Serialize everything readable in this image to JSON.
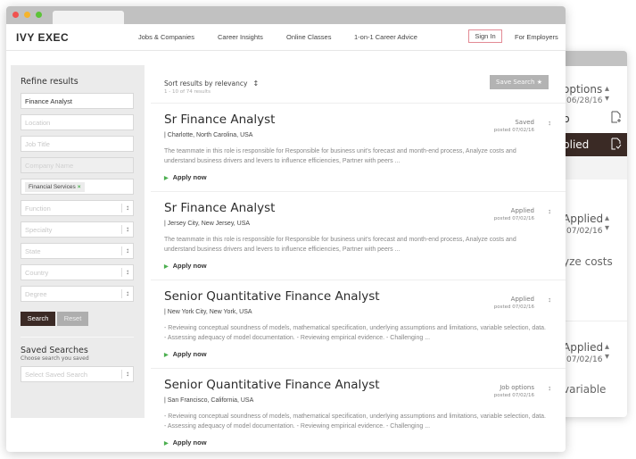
{
  "background_window": {
    "options_label": "options",
    "options_date": "06/28/16",
    "menu": [
      {
        "label": "b",
        "icon": "add-document-icon"
      },
      {
        "label": "plied",
        "icon": "checked-document-icon"
      }
    ],
    "cards": [
      {
        "status": "Applied",
        "date": "07/02/16",
        "text": "yze costs"
      },
      {
        "status": "Applied",
        "date": "07/02/16",
        "text": "variable"
      }
    ]
  },
  "browser": {
    "traffic_lights": [
      "close",
      "minimize",
      "maximize"
    ]
  },
  "navbar": {
    "logo": "IVY EXEC",
    "links": [
      "Jobs & Companies",
      "Career Insights",
      "Online Classes",
      "1-on-1 Career Advice"
    ],
    "sign_in": "Sign In",
    "for_employers": "For Employers"
  },
  "sidebar": {
    "title": "Refine results",
    "keyword_value": "Finance Analyst",
    "location_placeholder": "Location",
    "job_title_placeholder": "Job Title",
    "company_placeholder": "Company Name",
    "industry_chip": "Financial Services",
    "selects": [
      "Function",
      "Specialty",
      "State",
      "Country",
      "Degree"
    ],
    "search_button": "Search",
    "reset_button": "Reset",
    "saved_title": "Saved Searches",
    "saved_subtitle": "Choose search you saved",
    "saved_placeholder": "Select Saved Search"
  },
  "results": {
    "sort_label": "Sort results by relevancy",
    "count": "1 - 10 of 74 results",
    "save_search": "Save Search",
    "apply_label": "Apply now",
    "jobs": [
      {
        "title": "Sr Finance Analyst",
        "location": "| Charlotte, North Carolina, USA",
        "status": "Saved",
        "posted": "posted 07/02/16",
        "description": "The teammate in this role is responsible for Responsible for business unit's forecast and month-end process, Analyze costs and understand business drivers and levers to influence efficiencies,  Partner with peers ..."
      },
      {
        "title": "Sr Finance Analyst",
        "location": "| Jersey City, New Jersey, USA",
        "status": "Applied",
        "posted": "posted 07/02/16",
        "description": "The teammate in this role is responsible for Responsible for business unit's forecast and month-end process, Analyze costs and understand business drivers and levers to influence efficiencies,  Partner with peers ..."
      },
      {
        "title": "Senior Quantitative Finance Analyst",
        "location": "| New York City, New York, USA",
        "status": "Applied",
        "posted": "posted 07/02/16",
        "description": "- Reviewing conceptual soundness of models, mathematical specification, underlying assumptions and limitations, variable selection, data. - Assessing adequacy of model documentation. - Reviewing empirical evidence. - Challenging ..."
      },
      {
        "title": "Senior Quantitative Finance Analyst",
        "location": "| San Francisco, California, USA",
        "status": "Job options",
        "posted": "posted 07/02/16",
        "description": "- Reviewing conceptual soundness of models, mathematical specification, underlying assumptions and limitations, variable selection, data. - Assessing adequacy of model documentation. - Reviewing empirical evidence. - Challenging ..."
      }
    ]
  },
  "colors": {
    "brand_dark": "#3b2a25",
    "apply_green": "#4caf50",
    "sign_in_border": "#e38a94"
  }
}
